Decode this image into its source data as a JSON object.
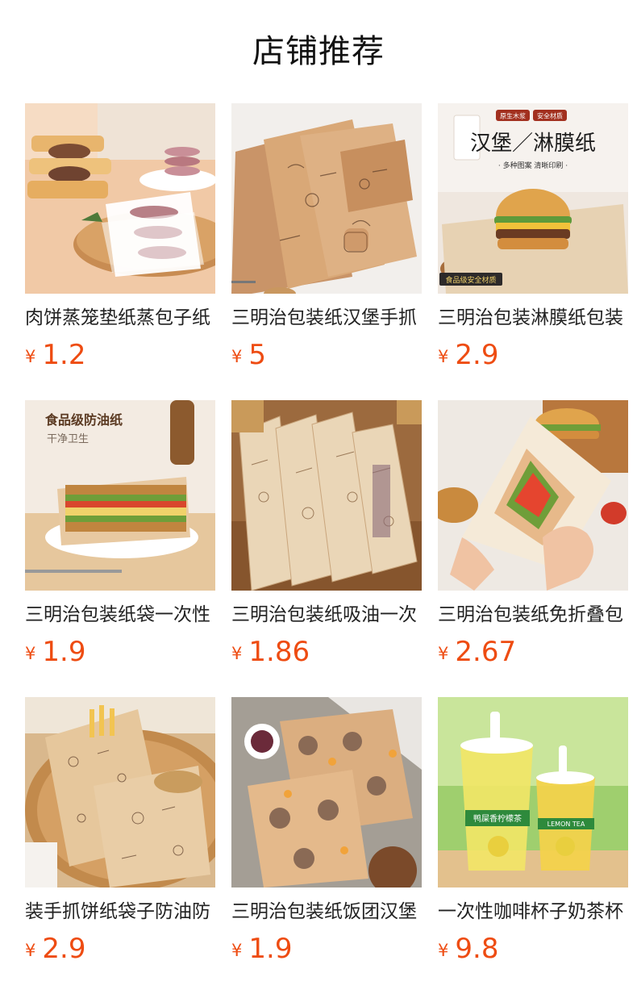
{
  "page": {
    "title": "店铺推荐"
  },
  "colors": {
    "price": "#ee4c12",
    "text": "#222222"
  },
  "products": [
    {
      "name": "肉饼蒸笼垫纸蒸包子纸",
      "currency": "¥",
      "price": "1.2",
      "image_icon": "burger-patty-paper-image"
    },
    {
      "name": "三明治包装纸汉堡手抓",
      "currency": "¥",
      "price": "5",
      "image_icon": "kraft-sandwich-paper-image"
    },
    {
      "name": "三明治包装淋膜纸包装",
      "currency": "¥",
      "price": "2.9",
      "image_icon": "burger-wrap-paper-image",
      "badges": [
        "原生木浆",
        "安全材质"
      ],
      "headline": "汉堡／淋膜纸",
      "subline": "· 多种图案  清晰印刷 ·",
      "corner": "食品级安全材质"
    },
    {
      "name": "三明治包装纸袋一次性",
      "currency": "¥",
      "price": "1.9",
      "image_icon": "sandwich-oil-proof-paper-image",
      "headline": "食品级防油纸",
      "subline": "干净卫生"
    },
    {
      "name": "三明治包装纸吸油一次",
      "currency": "¥",
      "price": "1.86",
      "image_icon": "rolled-sandwich-paper-image"
    },
    {
      "name": "三明治包装纸免折叠包",
      "currency": "¥",
      "price": "2.67",
      "image_icon": "hand-held-sandwich-image"
    },
    {
      "name": "装手抓饼纸袋子防油防",
      "currency": "¥",
      "price": "2.9",
      "image_icon": "pancake-paper-bag-image"
    },
    {
      "name": "三明治包装纸饭团汉堡",
      "currency": "¥",
      "price": "1.9",
      "image_icon": "bear-print-paper-image"
    },
    {
      "name": "一次性咖啡杯子奶茶杯",
      "currency": "¥",
      "price": "9.8",
      "image_icon": "milk-tea-cup-image",
      "cup_label": "鸭屎香柠檬茶",
      "cup_label2": "LEMON TEA"
    }
  ]
}
